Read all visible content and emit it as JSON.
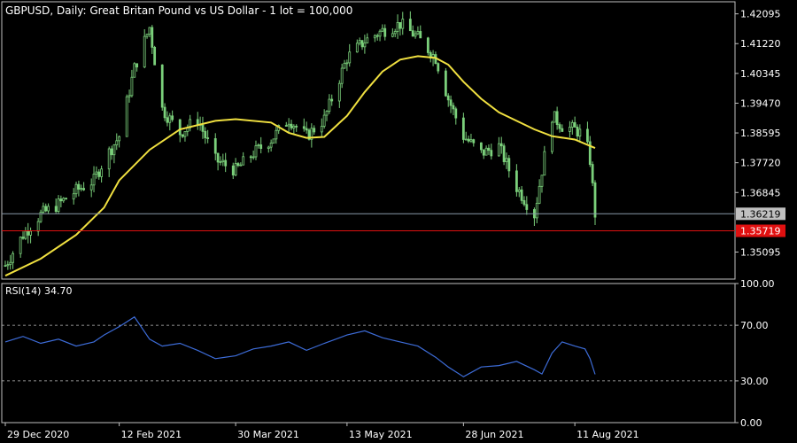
{
  "header": {
    "title": "GBPUSD, Daily:  Great Britan Pound vs US Dollar - 1 lot = 100,000"
  },
  "colors": {
    "background": "#000000",
    "grid": "#c0c0c0",
    "candle": "#7bd07b",
    "moving_average": "#f0e040",
    "rsi_line": "#3d6cd8",
    "bid_line": "#8898a8",
    "level_line": "#e01010",
    "price_tag_bid": "#c0c0c0",
    "price_tag_level": "#e01010"
  },
  "chart_data": [
    {
      "type": "candlestick",
      "title": "GBPUSD, Daily:  Great Britan Pound vs US Dollar - 1 lot = 100,000",
      "ylim": [
        1.343,
        1.4245
      ],
      "y_ticks": [
        "1.42095",
        "1.41220",
        "1.40345",
        "1.39470",
        "1.38595",
        "1.37720",
        "1.36845",
        "1.35095"
      ],
      "x_ticks": [
        "29 Dec 2020",
        "12 Feb 2021",
        "30 Mar 2021",
        "13 May 2021",
        "28 Jun 2021",
        "11 Aug 2021"
      ],
      "close_series": [
        {
          "date": "29 Dec 2020",
          "value": 1.347
        },
        {
          "date": "05 Jan 2021",
          "value": 1.356
        },
        {
          "date": "12 Jan 2021",
          "value": 1.362
        },
        {
          "date": "19 Jan 2021",
          "value": 1.365
        },
        {
          "date": "26 Jan 2021",
          "value": 1.369
        },
        {
          "date": "02 Feb 2021",
          "value": 1.372
        },
        {
          "date": "06 Feb 2021",
          "value": 1.378
        },
        {
          "date": "12 Feb 2021",
          "value": 1.385
        },
        {
          "date": "18 Feb 2021",
          "value": 1.405
        },
        {
          "date": "24 Feb 2021",
          "value": 1.417
        },
        {
          "date": "01 Mar 2021",
          "value": 1.393
        },
        {
          "date": "08 Mar 2021",
          "value": 1.386
        },
        {
          "date": "15 Mar 2021",
          "value": 1.39
        },
        {
          "date": "22 Mar 2021",
          "value": 1.378
        },
        {
          "date": "30 Mar 2021",
          "value": 1.375
        },
        {
          "date": "06 Apr 2021",
          "value": 1.38
        },
        {
          "date": "13 Apr 2021",
          "value": 1.384
        },
        {
          "date": "20 Apr 2021",
          "value": 1.39
        },
        {
          "date": "27 Apr 2021",
          "value": 1.385
        },
        {
          "date": "04 May 2021",
          "value": 1.39
        },
        {
          "date": "13 May 2021",
          "value": 1.408
        },
        {
          "date": "20 May 2021",
          "value": 1.413
        },
        {
          "date": "27 May 2021",
          "value": 1.416
        },
        {
          "date": "03 Jun 2021",
          "value": 1.418
        },
        {
          "date": "10 Jun 2021",
          "value": 1.414
        },
        {
          "date": "17 Jun 2021",
          "value": 1.408
        },
        {
          "date": "22 Jun 2021",
          "value": 1.396
        },
        {
          "date": "28 Jun 2021",
          "value": 1.385
        },
        {
          "date": "05 Jul 2021",
          "value": 1.38
        },
        {
          "date": "12 Jul 2021",
          "value": 1.382
        },
        {
          "date": "19 Jul 2021",
          "value": 1.37
        },
        {
          "date": "26 Jul 2021",
          "value": 1.362
        },
        {
          "date": "29 Jul 2021",
          "value": 1.375
        },
        {
          "date": "02 Aug 2021",
          "value": 1.391
        },
        {
          "date": "06 Aug 2021",
          "value": 1.388
        },
        {
          "date": "11 Aug 2021",
          "value": 1.387
        },
        {
          "date": "15 Aug 2021",
          "value": 1.385
        },
        {
          "date": "17 Aug 2021",
          "value": 1.378
        },
        {
          "date": "19 Aug 2021",
          "value": 1.3622
        }
      ],
      "moving_average": [
        {
          "date": "29 Dec 2020",
          "value": 1.344
        },
        {
          "date": "12 Jan 2021",
          "value": 1.349
        },
        {
          "date": "26 Jan 2021",
          "value": 1.356
        },
        {
          "date": "06 Feb 2021",
          "value": 1.364
        },
        {
          "date": "12 Feb 2021",
          "value": 1.372
        },
        {
          "date": "24 Feb 2021",
          "value": 1.381
        },
        {
          "date": "08 Mar 2021",
          "value": 1.387
        },
        {
          "date": "22 Mar 2021",
          "value": 1.3895
        },
        {
          "date": "30 Mar 2021",
          "value": 1.39
        },
        {
          "date": "13 Apr 2021",
          "value": 1.389
        },
        {
          "date": "20 Apr 2021",
          "value": 1.386
        },
        {
          "date": "27 Apr 2021",
          "value": 1.3845
        },
        {
          "date": "04 May 2021",
          "value": 1.3848
        },
        {
          "date": "13 May 2021",
          "value": 1.391
        },
        {
          "date": "20 May 2021",
          "value": 1.398
        },
        {
          "date": "27 May 2021",
          "value": 1.404
        },
        {
          "date": "03 Jun 2021",
          "value": 1.4075
        },
        {
          "date": "10 Jun 2021",
          "value": 1.4085
        },
        {
          "date": "17 Jun 2021",
          "value": 1.408
        },
        {
          "date": "22 Jun 2021",
          "value": 1.406
        },
        {
          "date": "28 Jun 2021",
          "value": 1.401
        },
        {
          "date": "05 Jul 2021",
          "value": 1.396
        },
        {
          "date": "12 Jul 2021",
          "value": 1.392
        },
        {
          "date": "26 Jul 2021",
          "value": 1.387
        },
        {
          "date": "02 Aug 2021",
          "value": 1.385
        },
        {
          "date": "11 Aug 2021",
          "value": 1.384
        },
        {
          "date": "19 Aug 2021",
          "value": 1.3815
        }
      ],
      "horizontal_lines": [
        {
          "label": "1.36219",
          "value": 1.36219,
          "kind": "bid"
        },
        {
          "label": "1.35719",
          "value": 1.35719,
          "kind": "level"
        }
      ]
    },
    {
      "type": "line",
      "title": "RSI(14) 34.70",
      "indicator": "RSI(14)",
      "current_value": "34.70",
      "ylim": [
        0,
        100
      ],
      "y_ticks": [
        "100.00",
        "70.00",
        "30.00",
        "0.00"
      ],
      "levels": [
        70,
        30
      ],
      "x": [
        "29 Dec 2020",
        "05 Jan 2021",
        "12 Jan 2021",
        "19 Jan 2021",
        "26 Jan 2021",
        "02 Feb 2021",
        "06 Feb 2021",
        "12 Feb 2021",
        "18 Feb 2021",
        "24 Feb 2021",
        "01 Mar 2021",
        "08 Mar 2021",
        "15 Mar 2021",
        "22 Mar 2021",
        "30 Mar 2021",
        "06 Apr 2021",
        "13 Apr 2021",
        "20 Apr 2021",
        "27 Apr 2021",
        "04 May 2021",
        "13 May 2021",
        "20 May 2021",
        "27 May 2021",
        "03 Jun 2021",
        "10 Jun 2021",
        "17 Jun 2021",
        "22 Jun 2021",
        "28 Jun 2021",
        "05 Jul 2021",
        "12 Jul 2021",
        "19 Jul 2021",
        "26 Jul 2021",
        "29 Jul 2021",
        "02 Aug 2021",
        "06 Aug 2021",
        "11 Aug 2021",
        "15 Aug 2021",
        "17 Aug 2021",
        "19 Aug 2021"
      ],
      "values": [
        58,
        62,
        57,
        60,
        55,
        58,
        63,
        69,
        76,
        60,
        55,
        57,
        52,
        46,
        48,
        53,
        55,
        58,
        52,
        57,
        63,
        66,
        61,
        58,
        55,
        47,
        40,
        33,
        40,
        41,
        44,
        38,
        35,
        50,
        58,
        55,
        53,
        46,
        34.7
      ]
    }
  ]
}
